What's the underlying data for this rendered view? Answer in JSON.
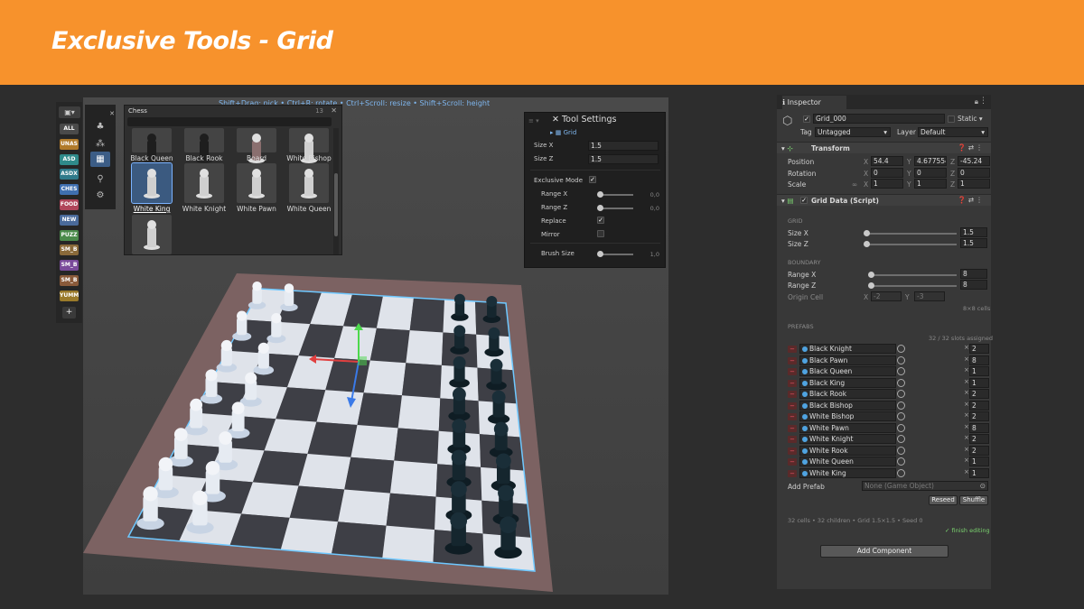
{
  "banner": {
    "title": "Exclusive Tools - Grid"
  },
  "viewport": {
    "hint": "Shift+Drag: pick  •  Ctrl+R: rotate  •  Ctrl+Scroll: resize  •  Shift+Scroll: height"
  },
  "categories": [
    {
      "label": "ALL",
      "color": "#4a4a4a"
    },
    {
      "label": "UNAS",
      "color": "#b07a2a"
    },
    {
      "label": "ASD",
      "color": "#2f8a8a"
    },
    {
      "label": "ASDX",
      "color": "#2f7a8a"
    },
    {
      "label": "CHES",
      "color": "#3f6fb0"
    },
    {
      "label": "FOOD",
      "color": "#b0455a"
    },
    {
      "label": "NEW",
      "color": "#4a6a9a"
    },
    {
      "label": "PUZZ",
      "color": "#4a8a4a"
    },
    {
      "label": "SM_B",
      "color": "#8a6a3a"
    },
    {
      "label": "SM_B",
      "color": "#7a4a9a"
    },
    {
      "label": "SM_B",
      "color": "#8a5a3a"
    },
    {
      "label": "YUMM",
      "color": "#9a7a2a"
    }
  ],
  "cat_add": "+",
  "palette": {
    "title": "Chess",
    "count": "13",
    "close": "✕",
    "items": [
      {
        "label": "Black Queen",
        "selected": false
      },
      {
        "label": "Black Rook",
        "selected": false
      },
      {
        "label": "Board",
        "selected": false
      },
      {
        "label": "White Bishop",
        "selected": false
      },
      {
        "label": "White King",
        "selected": true
      },
      {
        "label": "White Knight",
        "selected": false
      },
      {
        "label": "White Pawn",
        "selected": false
      },
      {
        "label": "White Queen",
        "selected": false
      },
      {
        "label": "",
        "selected": false
      }
    ]
  },
  "tool_settings": {
    "title": "Tool Settings",
    "grid_label": "Grid",
    "size_x_label": "Size X",
    "size_x": "1.5",
    "size_z_label": "Size Z",
    "size_z": "1.5",
    "exclusive_label": "Exclusive Mode",
    "exclusive": true,
    "range_x_label": "Range X",
    "range_x_val": "0,0",
    "range_z_label": "Range Z",
    "range_z_val": "0,0",
    "replace_label": "Replace",
    "replace": true,
    "mirror_label": "Mirror",
    "mirror": false,
    "brush_label": "Brush Size",
    "brush_val": "1,0"
  },
  "inspector": {
    "tab": "Inspector",
    "object_name": "Grid_000",
    "static_label": "Static",
    "tag_label": "Tag",
    "tag": "Untagged",
    "layer_label": "Layer",
    "layer": "Default",
    "transform": {
      "title": "Transform",
      "position_label": "Position",
      "rotation_label": "Rotation",
      "scale_label": "Scale",
      "pos": [
        "54.4",
        "4.677554",
        "-45.24"
      ],
      "rot": [
        "0",
        "0",
        "0"
      ],
      "scale": [
        "1",
        "1",
        "1"
      ],
      "axes": [
        "X",
        "Y",
        "Z"
      ]
    },
    "grid_data": {
      "title": "Grid Data (Script)",
      "grid_hdr": "GRID",
      "size_x_label": "Size X",
      "size_x": "1.5",
      "size_z_label": "Size Z",
      "size_z": "1.5",
      "boundary_hdr": "BOUNDARY",
      "range_x_label": "Range X",
      "range_x": "8",
      "range_z_label": "Range Z",
      "range_z": "8",
      "origin_label": "Origin Cell",
      "origin_x_label": "X",
      "origin_x": "-2",
      "origin_y_label": "Y",
      "origin_y": "-3",
      "cells_note": "8×8 cells",
      "prefabs_hdr": "PREFABS",
      "slots_note": "32 / 32 slots assigned",
      "prefabs": [
        {
          "name": "Black Knight",
          "count": "2"
        },
        {
          "name": "Black Pawn",
          "count": "8"
        },
        {
          "name": "Black Queen",
          "count": "1"
        },
        {
          "name": "Black King",
          "count": "1"
        },
        {
          "name": "Black Rook",
          "count": "2"
        },
        {
          "name": "Black Bishop",
          "count": "2"
        },
        {
          "name": "White Bishop",
          "count": "2"
        },
        {
          "name": "White Pawn",
          "count": "8"
        },
        {
          "name": "White Knight",
          "count": "2"
        },
        {
          "name": "White Rook",
          "count": "2"
        },
        {
          "name": "White Queen",
          "count": "1"
        },
        {
          "name": "White King",
          "count": "1"
        }
      ],
      "add_prefab_label": "Add Prefab",
      "add_prefab_value": "None (Game Object)",
      "reseed": "Reseed",
      "shuffle": "Shuffle",
      "footer": "32 cells  •  32 children  •  Grid 1.5×1.5  •  Seed 0",
      "finish": "✓ finish editing"
    },
    "add_component": "Add Component"
  }
}
